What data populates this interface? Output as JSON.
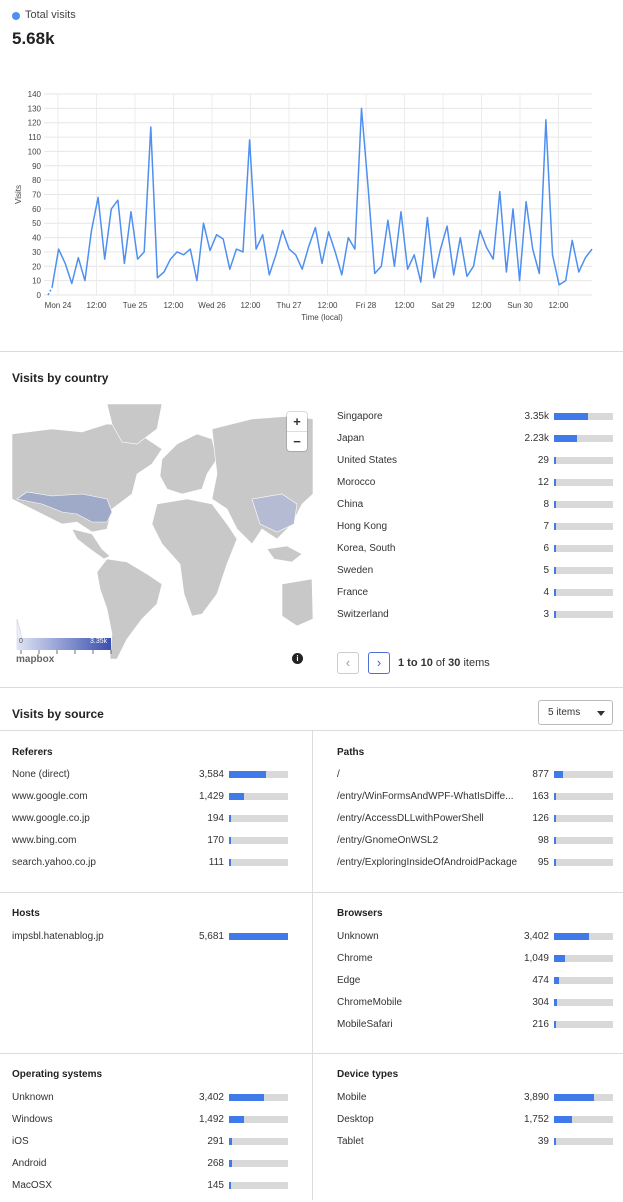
{
  "header": {
    "legend_label": "Total visits",
    "total_value": "5.68k",
    "series_color": "#4f8ff0"
  },
  "chart_data": {
    "type": "line",
    "ylabel": "Visits",
    "xlabel": "Time (local)",
    "ylim": [
      0,
      140
    ],
    "y_ticks": [
      "0",
      "10",
      "20",
      "30",
      "40",
      "50",
      "60",
      "70",
      "80",
      "90",
      "100",
      "110",
      "120",
      "130",
      "140"
    ],
    "x_tick_labels": [
      "Mon 24",
      "12:00",
      "Tue 25",
      "12:00",
      "Wed 26",
      "12:00",
      "Thu 27",
      "12:00",
      "Fri 28",
      "12:00",
      "Sat 29",
      "12:00",
      "Sun 30",
      "12:00"
    ],
    "grid": true,
    "x_unit": "hours from Mon 24 00:00",
    "series": [
      {
        "x": [
          0,
          2,
          4,
          6,
          8,
          10,
          12,
          14,
          16,
          18,
          20,
          22,
          24,
          26,
          28,
          30,
          32,
          34,
          36,
          38,
          40,
          42,
          44,
          46,
          48,
          50,
          52,
          54,
          56,
          58,
          60,
          62,
          64,
          66,
          68,
          70,
          72,
          74,
          76,
          78,
          80,
          82,
          84,
          86,
          88,
          90,
          92,
          94,
          96,
          98,
          100,
          102,
          104,
          106,
          108,
          110,
          112,
          114,
          116,
          118,
          120,
          122,
          124,
          126,
          128,
          130,
          132,
          134,
          136,
          138,
          140,
          142,
          144,
          146,
          148,
          150,
          152,
          154,
          156,
          158,
          160,
          162,
          164
        ],
        "values": [
          5,
          32,
          22,
          8,
          26,
          10,
          45,
          68,
          25,
          60,
          66,
          22,
          58,
          25,
          30,
          117,
          12,
          16,
          25,
          30,
          28,
          32,
          10,
          50,
          31,
          42,
          39,
          18,
          32,
          30,
          108,
          32,
          42,
          14,
          28,
          45,
          32,
          28,
          18,
          34,
          47,
          22,
          44,
          30,
          14,
          40,
          32,
          130,
          75,
          15,
          20,
          52,
          20,
          58,
          18,
          28,
          9,
          54,
          12,
          32,
          48,
          14,
          40,
          13,
          20,
          45,
          33,
          25,
          72,
          16,
          60,
          10,
          65,
          32,
          15,
          122,
          28,
          7,
          10,
          38,
          16,
          26,
          32
        ]
      }
    ]
  },
  "country": {
    "title": "Visits by country",
    "legend_min": "0",
    "legend_max": "3.35k",
    "map_attribution": "mapbox",
    "zoom_in": "+",
    "zoom_out": "−",
    "rows": [
      {
        "name": "Singapore",
        "value": "3.35k",
        "fill": 0.58
      },
      {
        "name": "Japan",
        "value": "2.23k",
        "fill": 0.39
      },
      {
        "name": "United States",
        "value": "29",
        "fill": 0.02
      },
      {
        "name": "Morocco",
        "value": "12",
        "fill": 0.01
      },
      {
        "name": "China",
        "value": "8",
        "fill": 0.01
      },
      {
        "name": "Hong Kong",
        "value": "7",
        "fill": 0.01
      },
      {
        "name": "Korea, South",
        "value": "6",
        "fill": 0.01
      },
      {
        "name": "Sweden",
        "value": "5",
        "fill": 0.005
      },
      {
        "name": "France",
        "value": "4",
        "fill": 0.005
      },
      {
        "name": "Switzerland",
        "value": "3",
        "fill": 0.005
      }
    ],
    "pager_prev": "‹",
    "pager_next": "›",
    "pager_range": "1 to 10",
    "pager_of": "of",
    "pager_total": "30",
    "pager_items": "items"
  },
  "source": {
    "title": "Visits by source",
    "select_value": "5 items",
    "referers": {
      "title": "Referers",
      "rows": [
        {
          "name": "None (direct)",
          "value": "3,584",
          "fill": 0.62
        },
        {
          "name": "www.google.com",
          "value": "1,429",
          "fill": 0.25
        },
        {
          "name": "www.google.co.jp",
          "value": "194",
          "fill": 0.03
        },
        {
          "name": "www.bing.com",
          "value": "170",
          "fill": 0.03
        },
        {
          "name": "search.yahoo.co.jp",
          "value": "111",
          "fill": 0.02
        }
      ]
    },
    "paths": {
      "title": "Paths",
      "rows": [
        {
          "name": "/",
          "value": "877",
          "fill": 0.15
        },
        {
          "name": "/entry/WinFormsAndWPF-WhatIsDiffe...",
          "value": "163",
          "fill": 0.03
        },
        {
          "name": "/entry/AccessDLLwithPowerShell",
          "value": "126",
          "fill": 0.02
        },
        {
          "name": "/entry/GnomeOnWSL2",
          "value": "98",
          "fill": 0.02
        },
        {
          "name": "/entry/ExploringInsideOfAndroidPackage",
          "value": "95",
          "fill": 0.02
        }
      ]
    },
    "hosts": {
      "title": "Hosts",
      "rows": [
        {
          "name": "impsbl.hatenablog.jp",
          "value": "5,681",
          "fill": 1.0
        }
      ]
    },
    "browsers": {
      "title": "Browsers",
      "rows": [
        {
          "name": "Unknown",
          "value": "3,402",
          "fill": 0.6
        },
        {
          "name": "Chrome",
          "value": "1,049",
          "fill": 0.19
        },
        {
          "name": "Edge",
          "value": "474",
          "fill": 0.08
        },
        {
          "name": "ChromeMobile",
          "value": "304",
          "fill": 0.05
        },
        {
          "name": "MobileSafari",
          "value": "216",
          "fill": 0.04
        }
      ]
    },
    "os": {
      "title": "Operating systems",
      "rows": [
        {
          "name": "Unknown",
          "value": "3,402",
          "fill": 0.6
        },
        {
          "name": "Windows",
          "value": "1,492",
          "fill": 0.26
        },
        {
          "name": "iOS",
          "value": "291",
          "fill": 0.05
        },
        {
          "name": "Android",
          "value": "268",
          "fill": 0.05
        },
        {
          "name": "MacOSX",
          "value": "145",
          "fill": 0.03
        }
      ]
    },
    "devices": {
      "title": "Device types",
      "rows": [
        {
          "name": "Mobile",
          "value": "3,890",
          "fill": 0.68
        },
        {
          "name": "Desktop",
          "value": "1,752",
          "fill": 0.31
        },
        {
          "name": "Tablet",
          "value": "39",
          "fill": 0.01
        }
      ]
    }
  }
}
